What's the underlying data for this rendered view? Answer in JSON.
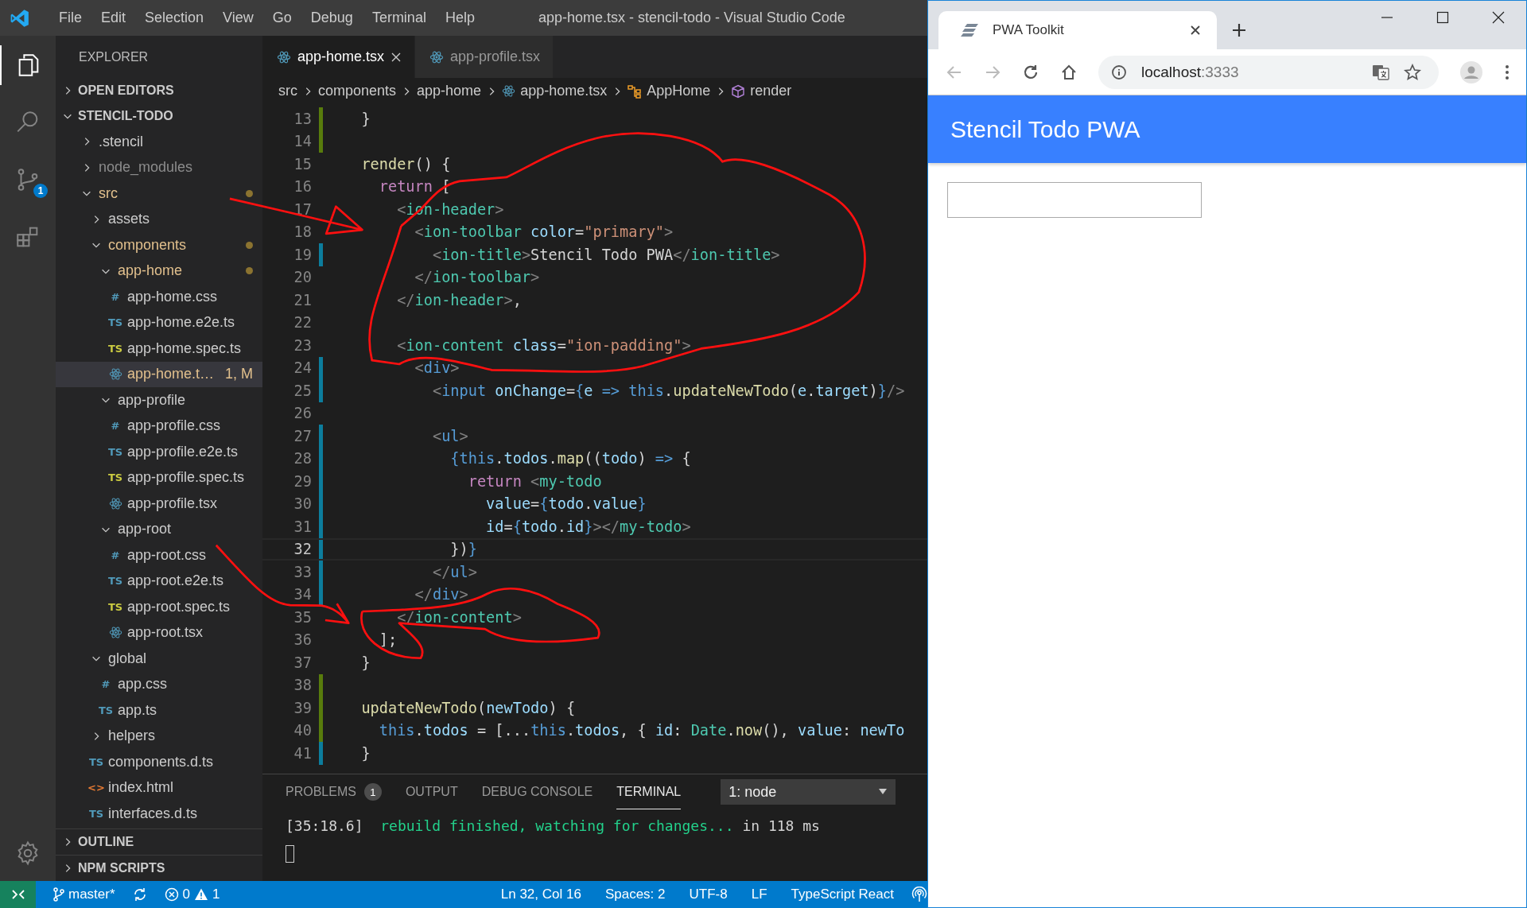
{
  "vscode": {
    "title": "app-home.tsx - stencil-todo - Visual Studio Code",
    "menu": [
      "File",
      "Edit",
      "Selection",
      "View",
      "Go",
      "Debug",
      "Terminal",
      "Help"
    ],
    "activity_bar": [
      {
        "kind": "files",
        "selected": true
      },
      {
        "kind": "search",
        "selected": false
      },
      {
        "kind": "source-control",
        "selected": false,
        "badge": "1"
      },
      {
        "kind": "extensions",
        "selected": false
      }
    ],
    "explorer": {
      "title": "EXPLORER",
      "sections": [
        {
          "label": "OPEN EDITORS",
          "expanded": false
        },
        {
          "label": "STENCIL-TODO",
          "expanded": true
        }
      ],
      "tree": [
        {
          "name": ".stencil",
          "kind": "folder",
          "expanded": false,
          "selected": false,
          "modified": false,
          "ignored": false
        },
        {
          "name": "node_modules",
          "kind": "folder",
          "expanded": false,
          "selected": false,
          "modified": false,
          "ignored": true
        },
        {
          "name": "src",
          "kind": "folder",
          "expanded": true,
          "selected": false,
          "modified": true,
          "ignored": false,
          "children": [
            {
              "name": "assets",
              "kind": "folder",
              "expanded": false,
              "selected": false,
              "modified": false,
              "ignored": false
            },
            {
              "name": "components",
              "kind": "folder",
              "expanded": true,
              "selected": false,
              "modified": true,
              "ignored": false,
              "children": [
                {
                  "name": "app-home",
                  "kind": "folder",
                  "expanded": true,
                  "selected": false,
                  "modified": true,
                  "ignored": false,
                  "children": [
                    {
                      "name": "app-home.css",
                      "kind": "css",
                      "icon_text": "#",
                      "selected": false,
                      "modified": false,
                      "ignored": false
                    },
                    {
                      "name": "app-home.e2e.ts",
                      "kind": "ts",
                      "icon_text": "TS",
                      "selected": false,
                      "modified": false,
                      "ignored": false
                    },
                    {
                      "name": "app-home.spec.ts",
                      "kind": "spec",
                      "icon_text": "TS",
                      "selected": false,
                      "modified": false,
                      "ignored": false
                    },
                    {
                      "name": "app-home.t…",
                      "kind": "tsx",
                      "selected": true,
                      "modified": true,
                      "ignored": false,
                      "badge": "1, M"
                    }
                  ]
                },
                {
                  "name": "app-profile",
                  "kind": "folder",
                  "expanded": true,
                  "selected": false,
                  "modified": false,
                  "ignored": false,
                  "children": [
                    {
                      "name": "app-profile.css",
                      "kind": "css",
                      "icon_text": "#",
                      "selected": false,
                      "modified": false,
                      "ignored": false
                    },
                    {
                      "name": "app-profile.e2e.ts",
                      "kind": "ts",
                      "icon_text": "TS",
                      "selected": false,
                      "modified": false,
                      "ignored": false
                    },
                    {
                      "name": "app-profile.spec.ts",
                      "kind": "spec",
                      "icon_text": "TS",
                      "selected": false,
                      "modified": false,
                      "ignored": false
                    },
                    {
                      "name": "app-profile.tsx",
                      "kind": "tsx",
                      "selected": false,
                      "modified": false,
                      "ignored": false
                    }
                  ]
                },
                {
                  "name": "app-root",
                  "kind": "folder",
                  "expanded": true,
                  "selected": false,
                  "modified": false,
                  "ignored": false,
                  "children": [
                    {
                      "name": "app-root.css",
                      "kind": "css",
                      "icon_text": "#",
                      "selected": false,
                      "modified": false,
                      "ignored": false
                    },
                    {
                      "name": "app-root.e2e.ts",
                      "kind": "ts",
                      "icon_text": "TS",
                      "selected": false,
                      "modified": false,
                      "ignored": false
                    },
                    {
                      "name": "app-root.spec.ts",
                      "kind": "spec",
                      "icon_text": "TS",
                      "selected": false,
                      "modified": false,
                      "ignored": false
                    },
                    {
                      "name": "app-root.tsx",
                      "kind": "tsx",
                      "selected": false,
                      "modified": false,
                      "ignored": false
                    }
                  ]
                }
              ]
            },
            {
              "name": "global",
              "kind": "folder",
              "expanded": true,
              "selected": false,
              "modified": false,
              "ignored": false,
              "children": [
                {
                  "name": "app.css",
                  "kind": "css",
                  "icon_text": "#",
                  "selected": false,
                  "modified": false,
                  "ignored": false
                },
                {
                  "name": "app.ts",
                  "kind": "ts",
                  "icon_text": "TS",
                  "selected": false,
                  "modified": false,
                  "ignored": false
                }
              ]
            },
            {
              "name": "helpers",
              "kind": "folder",
              "expanded": false,
              "selected": false,
              "modified": false,
              "ignored": false
            },
            {
              "name": "components.d.ts",
              "kind": "ts",
              "icon_text": "TS",
              "selected": false,
              "modified": false,
              "ignored": false
            },
            {
              "name": "index.html",
              "kind": "html",
              "icon_text": "<>",
              "selected": false,
              "modified": false,
              "ignored": false
            },
            {
              "name": "interfaces.d.ts",
              "kind": "ts",
              "icon_text": "TS",
              "selected": false,
              "modified": false,
              "ignored": false
            }
          ]
        }
      ],
      "bottom_sections": [
        {
          "label": "OUTLINE",
          "expanded": false
        },
        {
          "label": "NPM SCRIPTS",
          "expanded": false
        }
      ]
    },
    "tabs": [
      {
        "label": "app-home.tsx",
        "selected": true
      },
      {
        "label": "app-profile.tsx",
        "selected": false
      }
    ],
    "breadcrumbs": [
      {
        "label": "src",
        "kind": "folder"
      },
      {
        "label": "components",
        "kind": "folder"
      },
      {
        "label": "app-home",
        "kind": "folder"
      },
      {
        "label": "app-home.tsx",
        "kind": "tsx"
      },
      {
        "label": "AppHome",
        "kind": "class"
      },
      {
        "label": "render",
        "kind": "method"
      }
    ],
    "code": [
      {
        "number": "13",
        "kind": "added",
        "current": false,
        "tokens": [
          {
            "text": "  }",
            "kind": "plain"
          }
        ]
      },
      {
        "number": "14",
        "kind": "added",
        "current": false
      },
      {
        "number": "15",
        "kind": "unchanged",
        "current": false,
        "tokens": [
          {
            "text": "  render",
            "kind": "fn"
          },
          {
            "text": "() {",
            "kind": "plain"
          }
        ]
      },
      {
        "number": "16",
        "kind": "unchanged",
        "current": false,
        "tokens": [
          {
            "text": "    return",
            "kind": "kw"
          },
          {
            "text": " [",
            "kind": "plain"
          }
        ]
      },
      {
        "number": "17",
        "kind": "unchanged",
        "current": false,
        "tokens": [
          {
            "text": "      <",
            "kind": "punct"
          },
          {
            "text": "ion-header",
            "kind": "comp"
          },
          {
            "text": ">",
            "kind": "punct"
          }
        ]
      },
      {
        "number": "18",
        "kind": "unchanged",
        "current": false,
        "tokens": [
          {
            "text": "        <",
            "kind": "punct"
          },
          {
            "text": "ion-toolbar",
            "kind": "comp"
          },
          {
            "text": " color",
            "kind": "attr"
          },
          {
            "text": "=",
            "kind": "plain"
          },
          {
            "text": "\"primary\"",
            "kind": "str"
          },
          {
            "text": ">",
            "kind": "punct"
          }
        ]
      },
      {
        "number": "19",
        "kind": "modified",
        "current": false,
        "tokens": [
          {
            "text": "          <",
            "kind": "punct"
          },
          {
            "text": "ion-title",
            "kind": "comp"
          },
          {
            "text": ">",
            "kind": "punct"
          },
          {
            "text": "Stencil Todo PWA",
            "kind": "plain"
          },
          {
            "text": "</",
            "kind": "punct"
          },
          {
            "text": "ion-title",
            "kind": "comp"
          },
          {
            "text": ">",
            "kind": "punct"
          }
        ]
      },
      {
        "number": "20",
        "kind": "unchanged",
        "current": false,
        "tokens": [
          {
            "text": "        </",
            "kind": "punct"
          },
          {
            "text": "ion-toolbar",
            "kind": "comp"
          },
          {
            "text": ">",
            "kind": "punct"
          }
        ]
      },
      {
        "number": "21",
        "kind": "unchanged",
        "current": false,
        "tokens": [
          {
            "text": "      </",
            "kind": "punct"
          },
          {
            "text": "ion-header",
            "kind": "comp"
          },
          {
            "text": ">",
            "kind": "punct"
          },
          {
            "text": ",",
            "kind": "plain"
          }
        ]
      },
      {
        "number": "22",
        "kind": "unchanged",
        "current": false
      },
      {
        "number": "23",
        "kind": "unchanged",
        "current": false,
        "tokens": [
          {
            "text": "      <",
            "kind": "punct"
          },
          {
            "text": "ion-content",
            "kind": "comp"
          },
          {
            "text": " class",
            "kind": "attr"
          },
          {
            "text": "=",
            "kind": "plain"
          },
          {
            "text": "\"ion-padding\"",
            "kind": "str"
          },
          {
            "text": ">",
            "kind": "punct"
          }
        ]
      },
      {
        "number": "24",
        "kind": "modified",
        "current": false,
        "tokens": [
          {
            "text": "        <",
            "kind": "punct"
          },
          {
            "text": "div",
            "kind": "html"
          },
          {
            "text": ">",
            "kind": "punct"
          }
        ]
      },
      {
        "number": "25",
        "kind": "modified",
        "current": false,
        "tokens": [
          {
            "text": "          <",
            "kind": "punct"
          },
          {
            "text": "input",
            "kind": "html"
          },
          {
            "text": " onChange",
            "kind": "attr"
          },
          {
            "text": "=",
            "kind": "plain"
          },
          {
            "text": "{",
            "kind": "brace"
          },
          {
            "text": "e",
            "kind": "var"
          },
          {
            "text": " => this",
            "kind": "brace"
          },
          {
            "text": ".",
            "kind": "plain"
          },
          {
            "text": "updateNewTodo",
            "kind": "fn"
          },
          {
            "text": "(",
            "kind": "plain"
          },
          {
            "text": "e",
            "kind": "var"
          },
          {
            "text": ".",
            "kind": "plain"
          },
          {
            "text": "target",
            "kind": "var"
          },
          {
            "text": ")",
            "kind": "plain"
          },
          {
            "text": "}",
            "kind": "brace"
          },
          {
            "text": "/>",
            "kind": "punct"
          }
        ]
      },
      {
        "number": "26",
        "kind": "unchanged",
        "current": false
      },
      {
        "number": "27",
        "kind": "modified",
        "current": false,
        "tokens": [
          {
            "text": "          <",
            "kind": "punct"
          },
          {
            "text": "ul",
            "kind": "html"
          },
          {
            "text": ">",
            "kind": "punct"
          }
        ]
      },
      {
        "number": "28",
        "kind": "modified",
        "current": false,
        "tokens": [
          {
            "text": "            {this",
            "kind": "brace"
          },
          {
            "text": ".",
            "kind": "plain"
          },
          {
            "text": "todos",
            "kind": "var"
          },
          {
            "text": ".",
            "kind": "plain"
          },
          {
            "text": "map",
            "kind": "fn"
          },
          {
            "text": "((",
            "kind": "plain"
          },
          {
            "text": "todo",
            "kind": "var"
          },
          {
            "text": ") ",
            "kind": "plain"
          },
          {
            "text": "=>",
            "kind": "brace"
          },
          {
            "text": " {",
            "kind": "plain"
          }
        ]
      },
      {
        "number": "29",
        "kind": "modified",
        "current": false,
        "tokens": [
          {
            "text": "              return",
            "kind": "kw"
          },
          {
            "text": " <",
            "kind": "punct"
          },
          {
            "text": "my-todo",
            "kind": "comp"
          }
        ]
      },
      {
        "number": "30",
        "kind": "modified",
        "current": false,
        "tokens": [
          {
            "text": "                value",
            "kind": "attr"
          },
          {
            "text": "=",
            "kind": "plain"
          },
          {
            "text": "{",
            "kind": "brace"
          },
          {
            "text": "todo",
            "kind": "var"
          },
          {
            "text": ".",
            "kind": "plain"
          },
          {
            "text": "value",
            "kind": "var"
          },
          {
            "text": "}",
            "kind": "brace"
          }
        ]
      },
      {
        "number": "31",
        "kind": "modified",
        "current": false,
        "tokens": [
          {
            "text": "                id",
            "kind": "attr"
          },
          {
            "text": "=",
            "kind": "plain"
          },
          {
            "text": "{",
            "kind": "brace"
          },
          {
            "text": "todo",
            "kind": "var"
          },
          {
            "text": ".",
            "kind": "plain"
          },
          {
            "text": "id",
            "kind": "var"
          },
          {
            "text": "}",
            "kind": "brace"
          },
          {
            "text": "></",
            "kind": "punct"
          },
          {
            "text": "my-todo",
            "kind": "comp"
          },
          {
            "text": ">",
            "kind": "punct"
          }
        ]
      },
      {
        "number": "32",
        "kind": "modified",
        "current": true,
        "tokens": [
          {
            "text": "            })",
            "kind": "plain"
          },
          {
            "text": "}",
            "kind": "brace"
          }
        ]
      },
      {
        "number": "33",
        "kind": "modified",
        "current": false,
        "tokens": [
          {
            "text": "          </",
            "kind": "punct"
          },
          {
            "text": "ul",
            "kind": "html"
          },
          {
            "text": ">",
            "kind": "punct"
          }
        ]
      },
      {
        "number": "34",
        "kind": "modified",
        "current": false,
        "tokens": [
          {
            "text": "        </",
            "kind": "punct"
          },
          {
            "text": "div",
            "kind": "html"
          },
          {
            "text": ">",
            "kind": "punct"
          }
        ]
      },
      {
        "number": "35",
        "kind": "unchanged",
        "current": false,
        "tokens": [
          {
            "text": "      </",
            "kind": "punct"
          },
          {
            "text": "ion-content",
            "kind": "comp"
          },
          {
            "text": ">",
            "kind": "punct"
          }
        ]
      },
      {
        "number": "36",
        "kind": "unchanged",
        "current": false,
        "tokens": [
          {
            "text": "    ];",
            "kind": "plain"
          }
        ]
      },
      {
        "number": "37",
        "kind": "unchanged",
        "current": false,
        "tokens": [
          {
            "text": "  }",
            "kind": "plain"
          }
        ]
      },
      {
        "number": "38",
        "kind": "added",
        "current": false
      },
      {
        "number": "39",
        "kind": "added",
        "current": false,
        "tokens": [
          {
            "text": "  updateNewTodo",
            "kind": "fn"
          },
          {
            "text": "(",
            "kind": "plain"
          },
          {
            "text": "newTodo",
            "kind": "var"
          },
          {
            "text": ") {",
            "kind": "plain"
          }
        ]
      },
      {
        "number": "40",
        "kind": "added",
        "current": false,
        "tokens": [
          {
            "text": "    this",
            "kind": "brace"
          },
          {
            "text": ".",
            "kind": "plain"
          },
          {
            "text": "todos",
            "kind": "var"
          },
          {
            "text": " = [...",
            "kind": "plain"
          },
          {
            "text": "this",
            "kind": "brace"
          },
          {
            "text": ".",
            "kind": "plain"
          },
          {
            "text": "todos",
            "kind": "var"
          },
          {
            "text": ", { ",
            "kind": "plain"
          },
          {
            "text": "id",
            "kind": "var"
          },
          {
            "text": ": ",
            "kind": "plain"
          },
          {
            "text": "Date",
            "kind": "comp"
          },
          {
            "text": ".",
            "kind": "plain"
          },
          {
            "text": "now",
            "kind": "fn"
          },
          {
            "text": "(), ",
            "kind": "plain"
          },
          {
            "text": "value",
            "kind": "var"
          },
          {
            "text": ": ",
            "kind": "plain"
          },
          {
            "text": "newTo",
            "kind": "var"
          }
        ]
      },
      {
        "number": "41",
        "kind": "modified",
        "current": false,
        "tokens": [
          {
            "text": "  }",
            "kind": "plain"
          }
        ]
      }
    ],
    "panel": {
      "tabs": [
        {
          "label": "PROBLEMS",
          "selected": false,
          "badge": "1"
        },
        {
          "label": "OUTPUT",
          "selected": false
        },
        {
          "label": "DEBUG CONSOLE",
          "selected": false
        },
        {
          "label": "TERMINAL",
          "selected": true
        }
      ],
      "terminal_select": "1: node",
      "terminal_lines": [
        [
          {
            "text": "[35:18.6]  ",
            "kind": "plain"
          },
          {
            "text": "rebuild finished, watching for changes...",
            "kind": "success"
          },
          {
            "text": " in 118 ms",
            "kind": "plain"
          }
        ]
      ]
    },
    "status_bar": {
      "branch": "master*",
      "errors": "0",
      "warnings": "1",
      "right": [
        "Ln 32, Col 16",
        "Spaces: 2",
        "UTF-8",
        "LF",
        "TypeScript React"
      ]
    }
  },
  "browser": {
    "tab_title": "PWA Toolkit",
    "url_host": "localhost",
    "url_port": ":3333",
    "back_enabled": false,
    "forward_enabled": false,
    "page": {
      "toolbar_title": "Stencil Todo PWA"
    }
  }
}
